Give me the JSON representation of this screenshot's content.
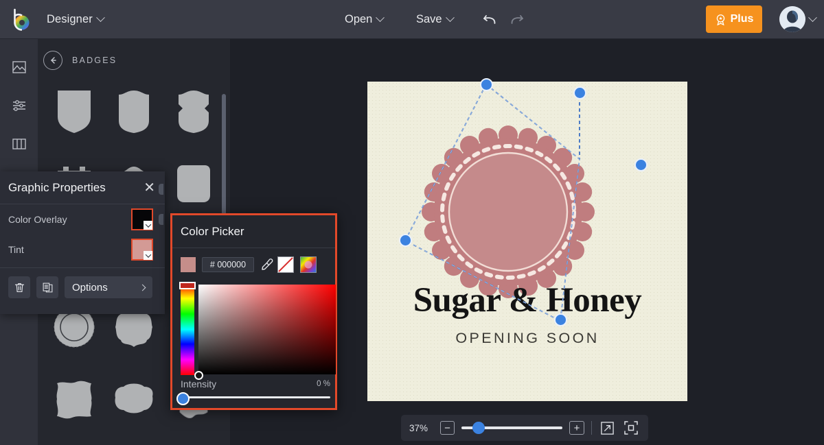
{
  "app": {
    "brand_label": "Designer",
    "logo_icon": "bethwheel-logo-icon"
  },
  "topbar": {
    "open_label": "Open",
    "save_label": "Save",
    "undo_icon": "undo-arrow-icon",
    "redo_icon": "redo-arrow-icon",
    "plus_label": "Plus",
    "plus_icon": "medal-badge-icon",
    "plus_color": "#f6921e",
    "avatar_icon": "user-avatar",
    "chevron_icon": "chevron-down-icon"
  },
  "rail": {
    "items": [
      {
        "name": "images-tool",
        "icon": "image-icon"
      },
      {
        "name": "adjustments-tool",
        "icon": "sliders-icon"
      },
      {
        "name": "layouts-tool",
        "icon": "columns-icon"
      },
      {
        "name": "favorites-tool",
        "icon": "heart-icon"
      }
    ]
  },
  "library": {
    "title": "BADGES",
    "back_icon": "back-arrow-circle-icon",
    "shapes": [
      "shield-pointed",
      "shield-crest",
      "shield-classic",
      "banner-castle",
      "banner-ribbon",
      "octagon-rounded",
      "scalloped-oval",
      "ornate-frame",
      "rosette-circle",
      "starburst-badge",
      "wavy-square",
      "cloud-badge",
      "ribbon-tall",
      "ornate-shield",
      "scroll-banner"
    ]
  },
  "canvas": {
    "zoom_level": "37%",
    "background_color": "#efeedd",
    "artwork": {
      "title": "Sugar & Honey",
      "subtitle": "OPENING SOON",
      "rosette_color": "#c07d7f",
      "rosette_name": "scalloped-rosette-badge"
    },
    "selection": {
      "handle_color": "#3b82e0",
      "handle_count": 5
    }
  },
  "zoombar": {
    "zoom_value": "37%",
    "minus_label": "−",
    "plus_label": "+",
    "expand_icon": "expand-arrow-icon",
    "fit_icon": "fit-to-screen-icon",
    "slider_percent": 12
  },
  "graphic_properties": {
    "title": "Graphic Properties",
    "close_icon": "close-icon",
    "rows": [
      {
        "label": "Color Overlay",
        "swatch": "#060608",
        "name": "color-overlay-swatch"
      },
      {
        "label": "Tint",
        "swatch": "#d39a95",
        "name": "tint-swatch"
      }
    ],
    "delete_icon": "trash-icon",
    "duplicate_icon": "duplicate-icon",
    "options_label": "Options",
    "options_chevron": "chevron-right-icon",
    "highlight_color": "#e2492a"
  },
  "color_picker": {
    "title": "Color Picker",
    "hex_value": "# 000000",
    "preview_color": "#c58e8a",
    "eyedropper_icon": "eyedropper-icon",
    "no_color_icon": "no-color-swatch",
    "color_wheel_icon": "color-wheel-icon",
    "intensity_label": "Intensity",
    "intensity_value": "0 %",
    "hue_selector_color": "#c0271d",
    "border_color": "#e2492a"
  }
}
